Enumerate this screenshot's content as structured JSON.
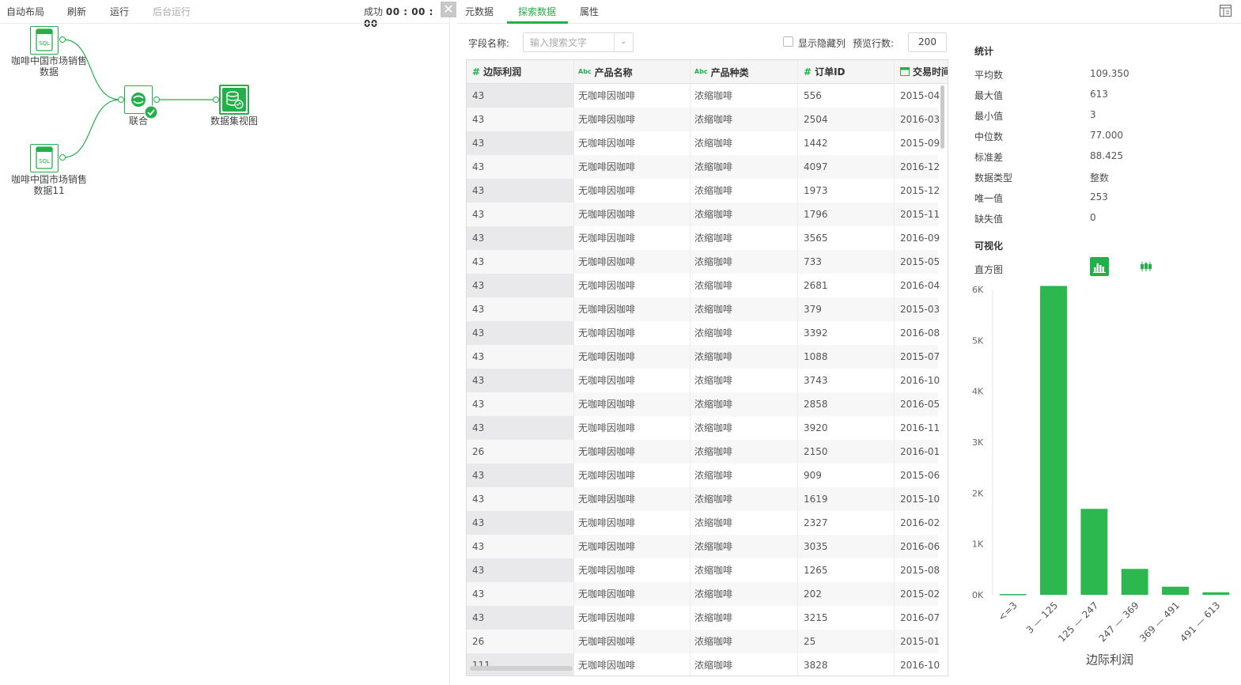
{
  "toolbar": {
    "auto_layout": "自动布局",
    "refresh": "刷新",
    "run": "运行",
    "background_run": "后台运行",
    "status_prefix": "成功",
    "status_time": "00 : 00 : 00"
  },
  "flow": {
    "source1_label_line1": "咖啡中国市场销售",
    "source1_label_line2": "数据",
    "source2_label_line1": "咖啡中国市场销售",
    "source2_label_line2": "数据11",
    "union_label": "联合",
    "view_label": "数据集视图",
    "sql_text": "SQL"
  },
  "tabs": [
    {
      "label": "元数据"
    },
    {
      "label": "探索数据"
    },
    {
      "label": "属性"
    }
  ],
  "filter": {
    "field_name_label": "字段名称:",
    "search_placeholder": "输入搜索文字",
    "show_hidden_label": "显示隐藏列",
    "preview_rows_label": "预览行数:",
    "preview_rows_value": "200"
  },
  "table": {
    "columns": [
      {
        "type_icon": "#",
        "label": "边际利润"
      },
      {
        "type_icon": "Abc",
        "label": "产品名称"
      },
      {
        "type_icon": "Abc",
        "label": "产品种类"
      },
      {
        "type_icon": "#",
        "label": "订单ID"
      },
      {
        "type_icon": "calendar-icon",
        "label": "交易时间"
      }
    ],
    "rows": [
      [
        "43",
        "无咖啡因咖啡",
        "浓缩咖啡",
        "556",
        "2015-04"
      ],
      [
        "43",
        "无咖啡因咖啡",
        "浓缩咖啡",
        "2504",
        "2016-03"
      ],
      [
        "43",
        "无咖啡因咖啡",
        "浓缩咖啡",
        "1442",
        "2015-09"
      ],
      [
        "43",
        "无咖啡因咖啡",
        "浓缩咖啡",
        "4097",
        "2016-12"
      ],
      [
        "43",
        "无咖啡因咖啡",
        "浓缩咖啡",
        "1973",
        "2015-12"
      ],
      [
        "43",
        "无咖啡因咖啡",
        "浓缩咖啡",
        "1796",
        "2015-11"
      ],
      [
        "43",
        "无咖啡因咖啡",
        "浓缩咖啡",
        "3565",
        "2016-09"
      ],
      [
        "43",
        "无咖啡因咖啡",
        "浓缩咖啡",
        "733",
        "2015-05"
      ],
      [
        "43",
        "无咖啡因咖啡",
        "浓缩咖啡",
        "2681",
        "2016-04"
      ],
      [
        "43",
        "无咖啡因咖啡",
        "浓缩咖啡",
        "379",
        "2015-03"
      ],
      [
        "43",
        "无咖啡因咖啡",
        "浓缩咖啡",
        "3392",
        "2016-08"
      ],
      [
        "43",
        "无咖啡因咖啡",
        "浓缩咖啡",
        "1088",
        "2015-07"
      ],
      [
        "43",
        "无咖啡因咖啡",
        "浓缩咖啡",
        "3743",
        "2016-10"
      ],
      [
        "43",
        "无咖啡因咖啡",
        "浓缩咖啡",
        "2858",
        "2016-05"
      ],
      [
        "43",
        "无咖啡因咖啡",
        "浓缩咖啡",
        "3920",
        "2016-11"
      ],
      [
        "26",
        "无咖啡因咖啡",
        "浓缩咖啡",
        "2150",
        "2016-01"
      ],
      [
        "43",
        "无咖啡因咖啡",
        "浓缩咖啡",
        "909",
        "2015-06"
      ],
      [
        "43",
        "无咖啡因咖啡",
        "浓缩咖啡",
        "1619",
        "2015-10"
      ],
      [
        "43",
        "无咖啡因咖啡",
        "浓缩咖啡",
        "2327",
        "2016-02"
      ],
      [
        "43",
        "无咖啡因咖啡",
        "浓缩咖啡",
        "3035",
        "2016-06"
      ],
      [
        "43",
        "无咖啡因咖啡",
        "浓缩咖啡",
        "1265",
        "2015-08"
      ],
      [
        "43",
        "无咖啡因咖啡",
        "浓缩咖啡",
        "202",
        "2015-02"
      ],
      [
        "43",
        "无咖啡因咖啡",
        "浓缩咖啡",
        "3215",
        "2016-07"
      ],
      [
        "26",
        "无咖啡因咖啡",
        "浓缩咖啡",
        "25",
        "2015-01"
      ],
      [
        "111",
        "无咖啡因咖啡",
        "浓缩咖啡",
        "3828",
        "2016-10"
      ]
    ]
  },
  "stats": {
    "title": "统计",
    "items": [
      {
        "key": "平均数",
        "value": "109.350"
      },
      {
        "key": "最大值",
        "value": "613"
      },
      {
        "key": "最小值",
        "value": "3"
      },
      {
        "key": "中位数",
        "value": "77.000"
      },
      {
        "key": "标准差",
        "value": "88.425"
      },
      {
        "key": "数据类型",
        "value": "整数"
      },
      {
        "key": "唯一值",
        "value": "253"
      },
      {
        "key": "缺失值",
        "value": "0"
      }
    ],
    "viz_title": "可视化",
    "histogram_label": "直方图"
  },
  "colors": {
    "accent": "#23b04a",
    "bar": "#2db84f"
  },
  "chart_data": {
    "type": "bar",
    "categories": [
      "<=3",
      "3 — 125",
      "125 — 247",
      "247 — 369",
      "369 — 491",
      "491 — 613"
    ],
    "values": [
      15,
      6070,
      1690,
      510,
      160,
      50
    ],
    "xlabel": "边际利润",
    "yticks": [
      "0K",
      "1K",
      "2K",
      "3K",
      "4K",
      "5K",
      "6K"
    ],
    "ylim": [
      0,
      6000
    ]
  }
}
